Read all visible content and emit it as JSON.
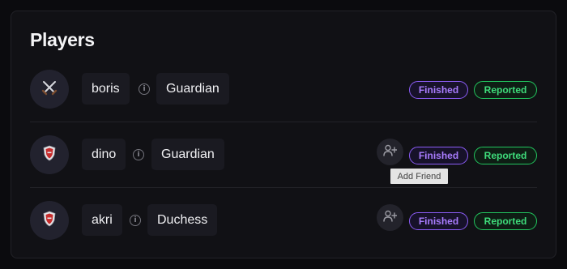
{
  "panel": {
    "title": "Players"
  },
  "players": [
    {
      "name": "boris",
      "role": "Guardian",
      "avatar_icon": "crossed-swords-icon",
      "status": "Finished",
      "report": "Reported",
      "show_add_friend": false
    },
    {
      "name": "dino",
      "role": "Guardian",
      "avatar_icon": "shield-icon",
      "status": "Finished",
      "report": "Reported",
      "show_add_friend": true
    },
    {
      "name": "akri",
      "role": "Duchess",
      "avatar_icon": "shield-icon",
      "status": "Finished",
      "report": "Reported",
      "show_add_friend": true
    }
  ],
  "tooltip": {
    "text": "Add Friend"
  },
  "colors": {
    "finished": "#8b5cf6",
    "reported": "#22c55e",
    "background": "#111115"
  }
}
